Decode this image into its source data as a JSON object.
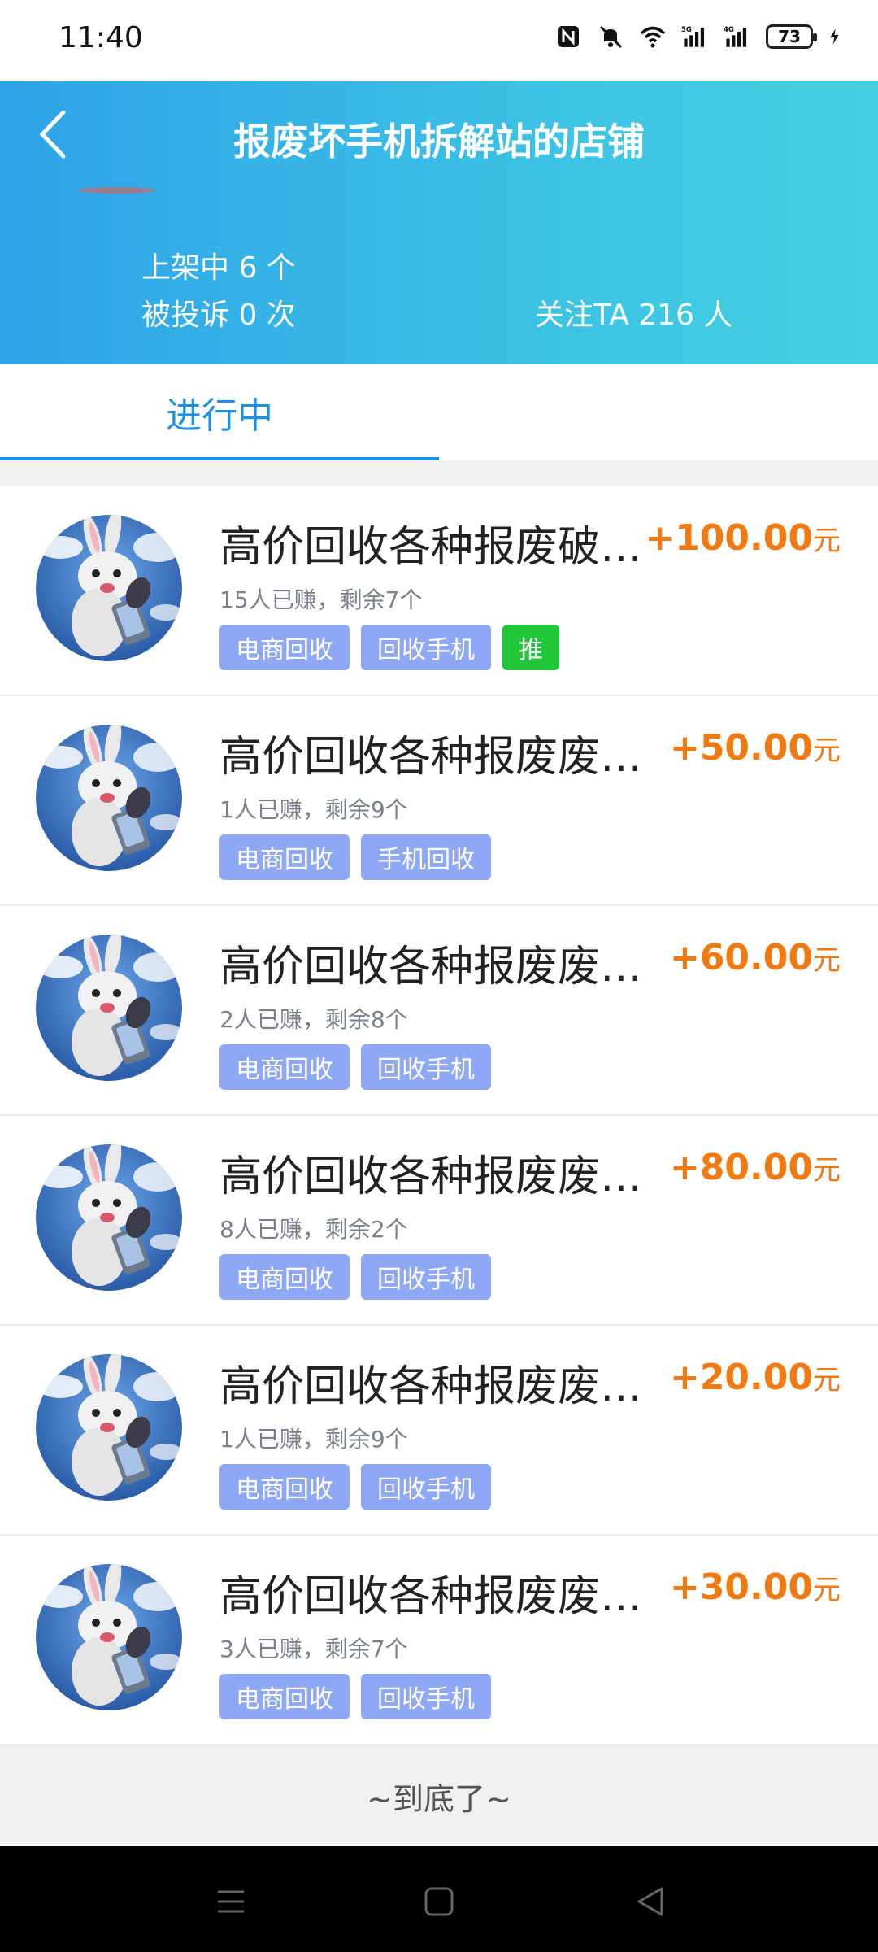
{
  "status_bar": {
    "time": "11:40",
    "battery": "73",
    "icons": [
      "nfc-icon",
      "mute-icon",
      "wifi-icon",
      "5g-signal-icon",
      "4g-signal-icon",
      "battery-icon",
      "charging-icon"
    ]
  },
  "header": {
    "title": "报废坏手机拆解站的店铺",
    "listing": "上架中 6 个",
    "complaints": "被投诉 0 次",
    "followers": "关注TA 216 人",
    "gradient_start": "#2ea3e8",
    "gradient_end": "#44d0e0"
  },
  "tabs": {
    "active": "进行中",
    "accent": "#1f8fe0"
  },
  "items": [
    {
      "title": "高价回收各种报废破…",
      "price": "+100.00",
      "unit": "元",
      "earned": "15人已赚，剩余7个",
      "tags": [
        "电商回收",
        "回收手机"
      ],
      "recommend": "推"
    },
    {
      "title": "高价回收各种报废废旧…",
      "price": "+50.00",
      "unit": "元",
      "earned": "1人已赚，剩余9个",
      "tags": [
        "电商回收",
        "手机回收"
      ]
    },
    {
      "title": "高价回收各种报废废旧…",
      "price": "+60.00",
      "unit": "元",
      "earned": "2人已赚，剩余8个",
      "tags": [
        "电商回收",
        "回收手机"
      ]
    },
    {
      "title": "高价回收各种报废废旧…",
      "price": "+80.00",
      "unit": "元",
      "earned": "8人已赚，剩余2个",
      "tags": [
        "电商回收",
        "回收手机"
      ]
    },
    {
      "title": "高价回收各种报废废旧…",
      "price": "+20.00",
      "unit": "元",
      "earned": "1人已赚，剩余9个",
      "tags": [
        "电商回收",
        "回收手机"
      ]
    },
    {
      "title": "高价回收各种报废废旧…",
      "price": "+30.00",
      "unit": "元",
      "earned": "3人已赚，剩余7个",
      "tags": [
        "电商回收",
        "回收手机"
      ]
    }
  ],
  "bottom_note": "~到底了~",
  "colors": {
    "price": "#f07a11",
    "tag": "#8ea8f5",
    "recommend": "#21c73a"
  }
}
